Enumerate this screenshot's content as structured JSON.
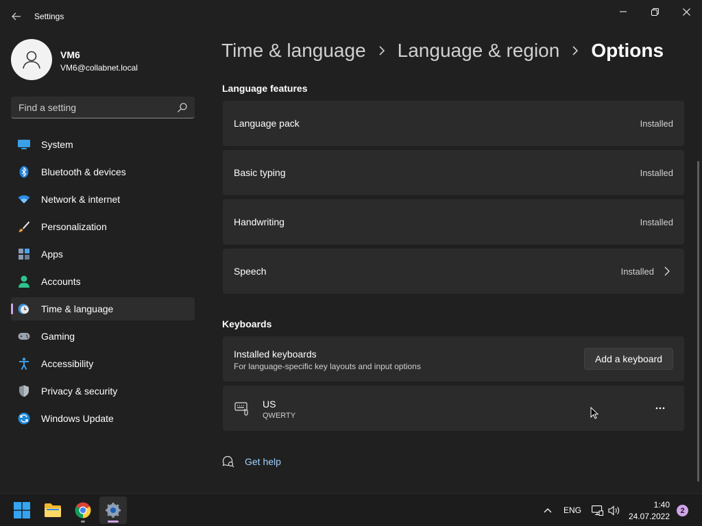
{
  "window": {
    "title": "Settings",
    "back_icon": "back-arrow-icon",
    "controls": [
      "minimize-icon",
      "restore-icon",
      "close-icon"
    ]
  },
  "profile": {
    "name": "VM6",
    "email": "VM6@collabnet.local"
  },
  "search": {
    "placeholder": "Find a setting"
  },
  "sidebar": {
    "items": [
      {
        "label": "System",
        "icon": "system-icon"
      },
      {
        "label": "Bluetooth & devices",
        "icon": "bluetooth-icon"
      },
      {
        "label": "Network & internet",
        "icon": "wifi-icon"
      },
      {
        "label": "Personalization",
        "icon": "brush-icon"
      },
      {
        "label": "Apps",
        "icon": "apps-icon"
      },
      {
        "label": "Accounts",
        "icon": "accounts-icon"
      },
      {
        "label": "Time & language",
        "icon": "time-language-icon",
        "active": true
      },
      {
        "label": "Gaming",
        "icon": "gamepad-icon"
      },
      {
        "label": "Accessibility",
        "icon": "accessibility-icon"
      },
      {
        "label": "Privacy & security",
        "icon": "shield-icon"
      },
      {
        "label": "Windows Update",
        "icon": "update-icon"
      }
    ]
  },
  "breadcrumb": {
    "items": [
      "Time & language",
      "Language & region"
    ],
    "current": "Options"
  },
  "language_features": {
    "title": "Language features",
    "items": [
      {
        "label": "Language pack",
        "status": "Installed"
      },
      {
        "label": "Basic typing",
        "status": "Installed"
      },
      {
        "label": "Handwriting",
        "status": "Installed"
      },
      {
        "label": "Speech",
        "status": "Installed",
        "expandable": true
      }
    ]
  },
  "keyboards": {
    "title": "Keyboards",
    "installed_title": "Installed keyboards",
    "installed_subtitle": "For language-specific key layouts and input options",
    "add_button": "Add a keyboard",
    "list": [
      {
        "name": "US",
        "layout": "QWERTY"
      }
    ]
  },
  "help": {
    "label": "Get help"
  },
  "taskbar": {
    "apps": [
      "start-icon",
      "file-explorer-icon",
      "chrome-icon",
      "settings-app-icon"
    ],
    "language": "ENG",
    "time": "1:40",
    "date": "24.07.2022",
    "notifications": "2"
  },
  "colors": {
    "background": "#202020",
    "card": "#2b2b2b",
    "accent": "#d0a4e8",
    "link": "#9fd0ff"
  }
}
